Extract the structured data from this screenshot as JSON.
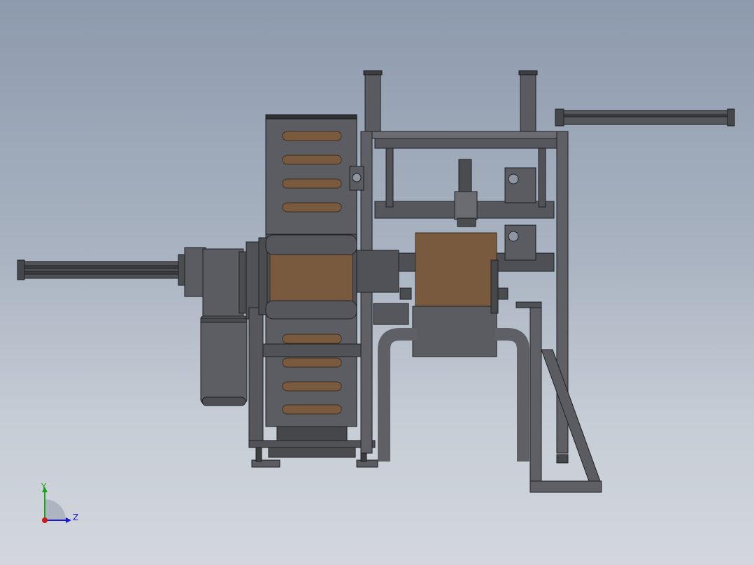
{
  "viewport": {
    "title": "",
    "background_top": "#8d9aad",
    "background_bottom": "#d3d7dd"
  },
  "colors": {
    "steel": "#55575c",
    "steel_dark": "#3b3d41",
    "steel_light": "#74777d",
    "edge": "#1f2023",
    "brown": "#7a5a3e",
    "brown_edge": "#3e2c1c"
  },
  "triad": {
    "y_label": "Y",
    "z_label": "Z",
    "y_color": "#1aa31a",
    "z_color": "#1a1ad0",
    "x_color": "#cc1a1a"
  }
}
